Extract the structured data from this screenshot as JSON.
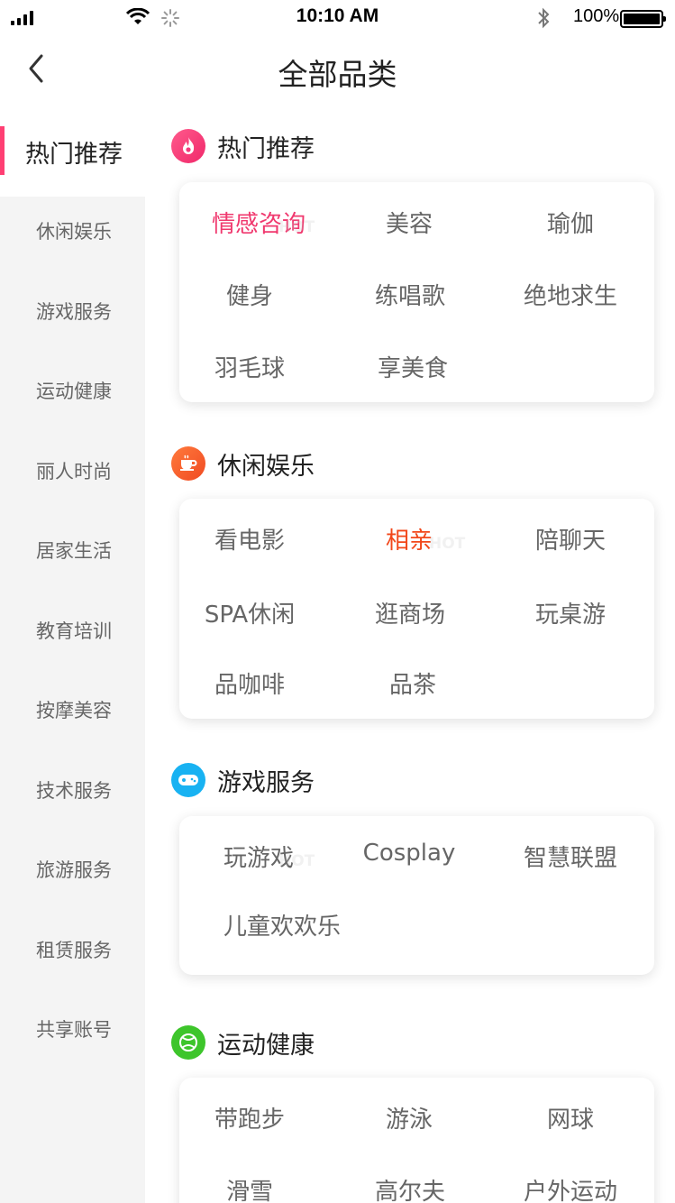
{
  "status_bar": {
    "time": "10:10 AM",
    "battery": "100%"
  },
  "header": {
    "title": "全部品类",
    "back_icon": "chevron-left-icon"
  },
  "sidebar": {
    "items": [
      {
        "label": "热门推荐",
        "active": true
      },
      {
        "label": "休闲娱乐"
      },
      {
        "label": "游戏服务"
      },
      {
        "label": "运动健康"
      },
      {
        "label": "丽人时尚"
      },
      {
        "label": "居家生活"
      },
      {
        "label": "教育培训"
      },
      {
        "label": "按摩美容"
      },
      {
        "label": "技术服务"
      },
      {
        "label": "旅游服务"
      },
      {
        "label": "租赁服务"
      },
      {
        "label": "共享账号"
      }
    ]
  },
  "sections": [
    {
      "title": "热门推荐",
      "icon": "flame-icon",
      "color": "#f5397c",
      "tags": [
        "情感咨询",
        "美容",
        "瑜伽",
        "健身",
        "练唱歌",
        "绝地求生",
        "羽毛球",
        "享美食"
      ],
      "highlight": "情感咨询",
      "hot_label": "HOT"
    },
    {
      "title": "休闲娱乐",
      "icon": "coffee-cup-icon",
      "color": "#f5572c",
      "tags": [
        "看电影",
        "相亲",
        "陪聊天",
        "SPA休闲",
        "逛商场",
        "玩桌游",
        "品咖啡",
        "品茶"
      ],
      "highlight": "相亲",
      "hot_label": "HOT"
    },
    {
      "title": "游戏服务",
      "icon": "gamepad-icon",
      "color": "#1ab0f0",
      "tags": [
        "玩游戏",
        "Cosplay",
        "智慧联盟",
        "儿童欢欢乐"
      ],
      "hot_label": "HOT"
    },
    {
      "title": "运动健康",
      "icon": "ball-icon",
      "color": "#3fc62a",
      "tags": [
        "带跑步",
        "游泳",
        "网球",
        "滑雪",
        "高尔夫",
        "户外运动"
      ]
    }
  ]
}
